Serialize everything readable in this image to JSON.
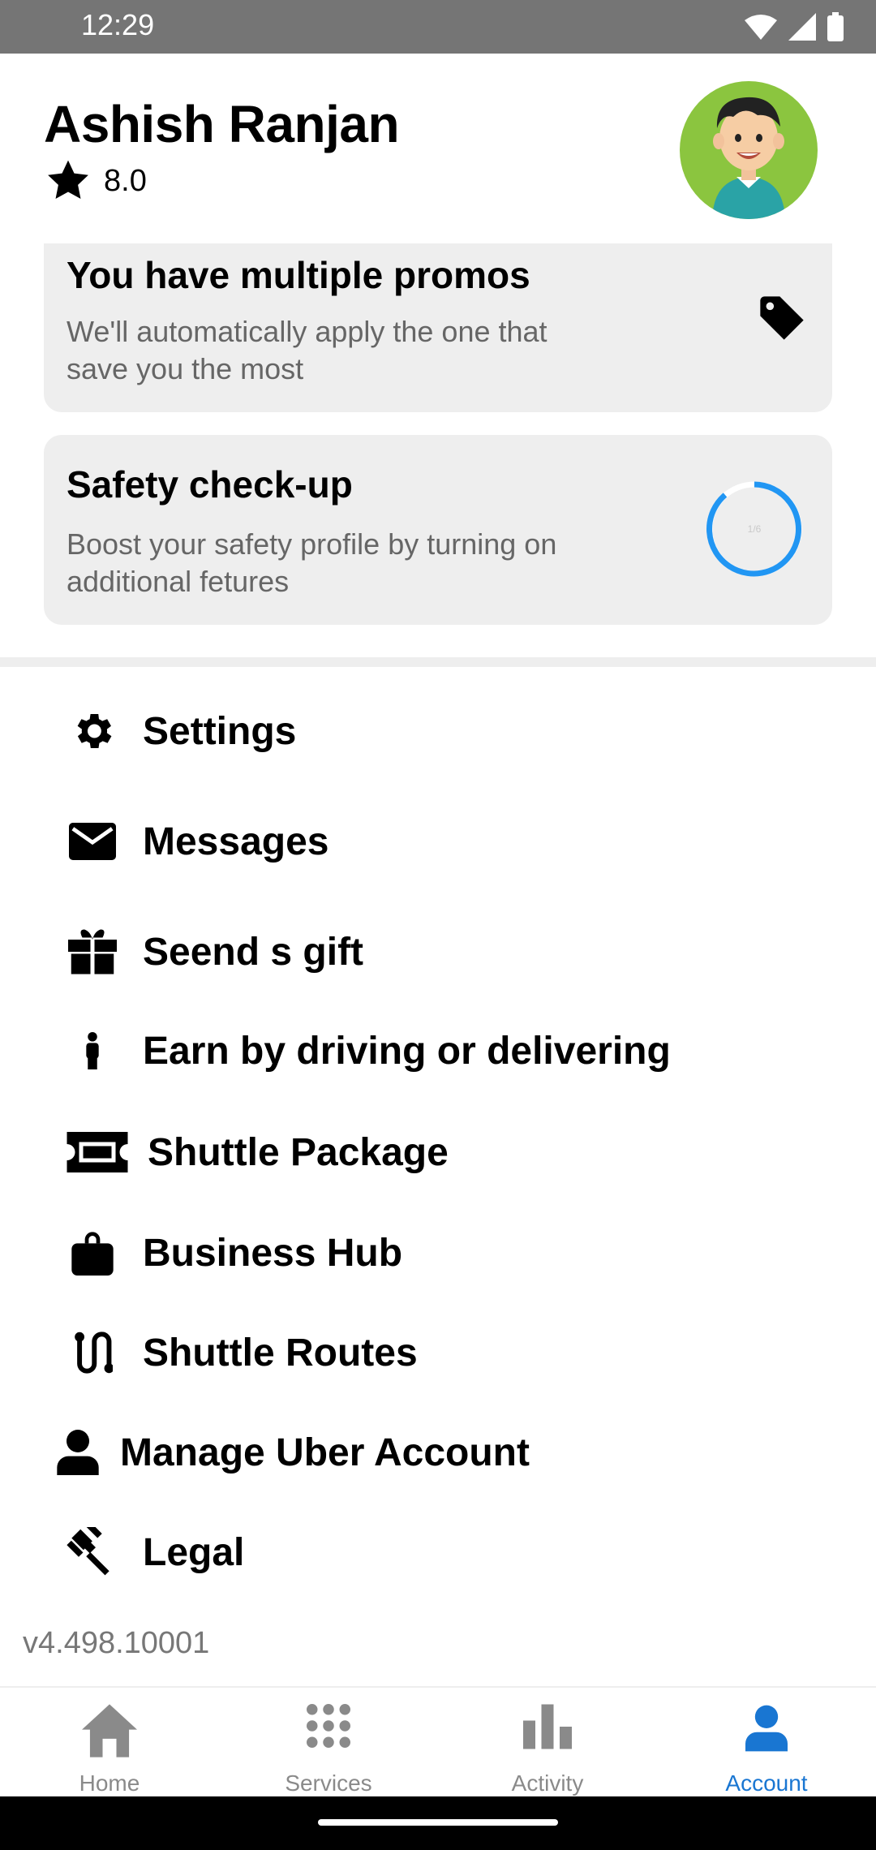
{
  "status_bar": {
    "time": "12:29"
  },
  "profile": {
    "name": "Ashish Ranjan",
    "rating": "8.0"
  },
  "promo_card": {
    "title": "You have multiple promos",
    "description": "We'll automatically apply the one that save you the most"
  },
  "safety_card": {
    "title": "Safety check-up",
    "description": "Boost your safety profile by turning on additional fetures",
    "progress_label": "1/6"
  },
  "menu": [
    {
      "label": "Settings",
      "icon": "gear-icon"
    },
    {
      "label": "Messages",
      "icon": "mail-icon"
    },
    {
      "label": "Seend s gift",
      "icon": "gift-icon"
    },
    {
      "label": "Earn by driving or delivering",
      "icon": "person-icon"
    },
    {
      "label": "Shuttle Package",
      "icon": "ticket-icon"
    },
    {
      "label": "Business Hub",
      "icon": "briefcase-icon"
    },
    {
      "label": "Shuttle Routes",
      "icon": "route-icon"
    },
    {
      "label": "Manage Uber Account",
      "icon": "account-icon"
    },
    {
      "label": "Legal",
      "icon": "gavel-icon"
    }
  ],
  "version": "v4.498.10001",
  "bottom_nav": [
    {
      "label": "Home",
      "icon": "home-icon"
    },
    {
      "label": "Services",
      "icon": "grid-icon"
    },
    {
      "label": "Activity",
      "icon": "bar-chart-icon"
    },
    {
      "label": "Account",
      "icon": "account-icon",
      "active": true
    }
  ],
  "colors": {
    "accent": "#1976d2",
    "progress": "#2196f3",
    "avatar_bg": "#8bc53f",
    "card_bg": "#eeeeee"
  }
}
